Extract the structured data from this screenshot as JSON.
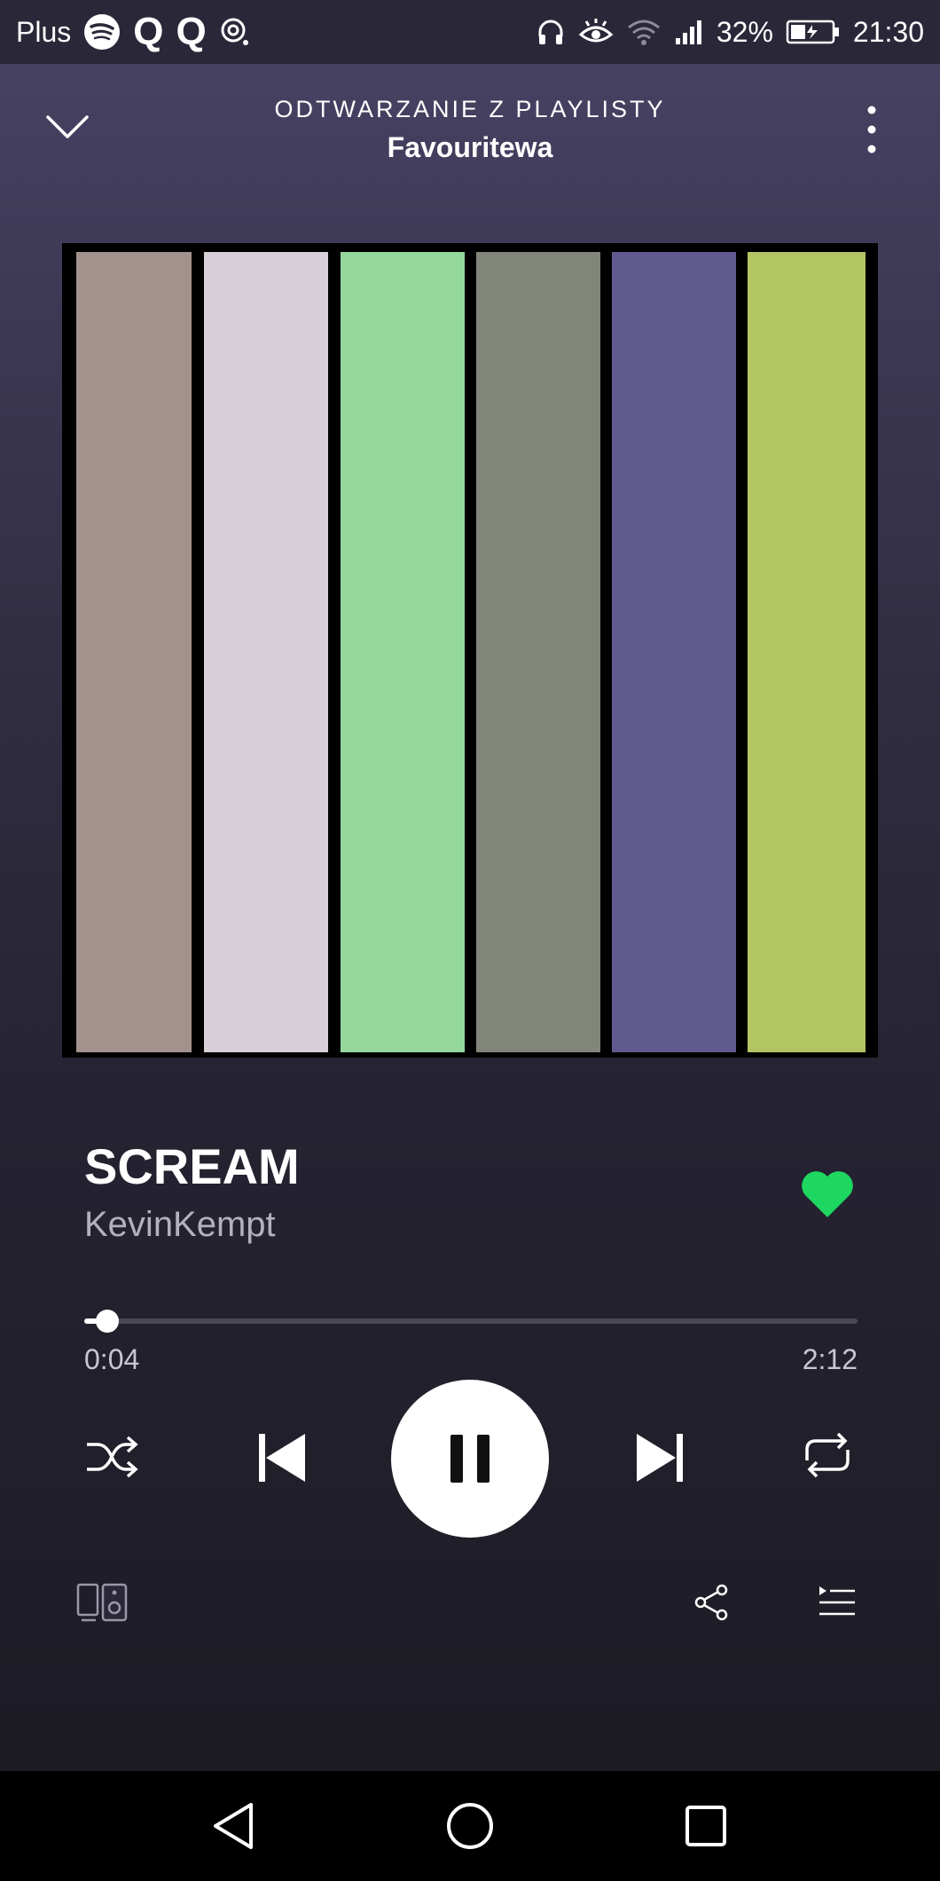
{
  "status_bar": {
    "carrier": "Plus",
    "battery": "32%",
    "time": "21:30"
  },
  "header": {
    "context": "ODTWARZANIE Z PLAYLISTY",
    "playlist": "Favouritewa"
  },
  "album_art": {
    "stripe_colors": [
      "#a3918e",
      "#d8cfd8",
      "#94d89c",
      "#82857a",
      "#605a8e",
      "#b3c463"
    ]
  },
  "track": {
    "title": "SCREAM",
    "artist": "KevinKempt",
    "liked": true
  },
  "progress": {
    "elapsed": "0:04",
    "total": "2:12",
    "fraction": 0.03
  },
  "colors": {
    "accent": "#1ed760",
    "text_secondary": "#b3b1bc"
  }
}
